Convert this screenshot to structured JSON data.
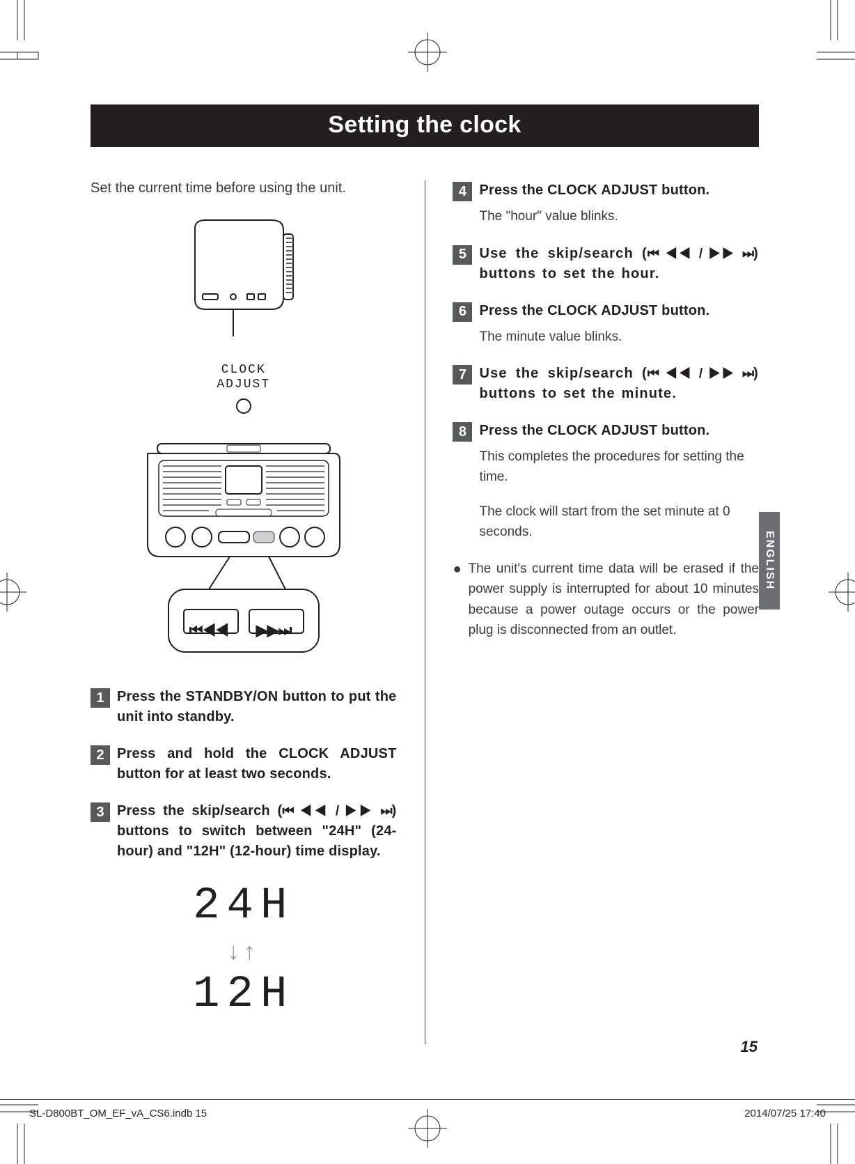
{
  "title": "Setting the clock",
  "intro": "Set the current time before using the unit.",
  "clock_label_1": "CLOCK",
  "clock_label_2": "ADJUST",
  "remote": {
    "btn_prev": "⏮◀◀",
    "btn_next": "▶▶⏭"
  },
  "steps": [
    {
      "n": "1",
      "title_a": "Press the STANDBY/ON button to put the unit into standby.",
      "body": ""
    },
    {
      "n": "2",
      "title_a": "Press and hold the CLOCK ADJUST button for at least two seconds.",
      "body": ""
    },
    {
      "n": "3",
      "title_a": "Press the skip/search (",
      "title_b": ") buttons to switch between \"24H\" (24-hour) and \"12H\" (12-hour) time display.",
      "icons": "⏮ ◀◀ / ▶▶ ⏭",
      "body": ""
    },
    {
      "n": "4",
      "title_a": "Press the CLOCK ADJUST button.",
      "body": "The \"hour\" value blinks."
    },
    {
      "n": "5",
      "title_a": "Use the skip/search (",
      "title_b": ") buttons to set the hour.",
      "icons": "⏮ ◀◀ / ▶▶ ⏭",
      "body": "",
      "wide": true
    },
    {
      "n": "6",
      "title_a": "Press the CLOCK ADJUST button.",
      "body": "The minute value blinks."
    },
    {
      "n": "7",
      "title_a": "Use the skip/search (",
      "title_b": ") buttons to set the minute.",
      "icons": "⏮ ◀◀ / ▶▶ ⏭",
      "body": "",
      "wide": true
    },
    {
      "n": "8",
      "title_a": "Press the CLOCK ADJUST button.",
      "body": "This completes the procedures for setting the time.",
      "body2": "The clock will start from the set minute at 0 seconds."
    }
  ],
  "note_bullet": "●",
  "note_text": "The unit's current time data will be erased if the power supply is interrupted for about 10 minutes because a power outage occurs or the power plug is disconnected from an outlet.",
  "seg": {
    "line1": "24H",
    "line2": "12H",
    "arrows": "↓↑"
  },
  "lang_tab": "ENGLISH",
  "page_number": "15",
  "footer_left": "SL-D800BT_OM_EF_vA_CS6.indb   15",
  "footer_right": "2014/07/25   17:40"
}
